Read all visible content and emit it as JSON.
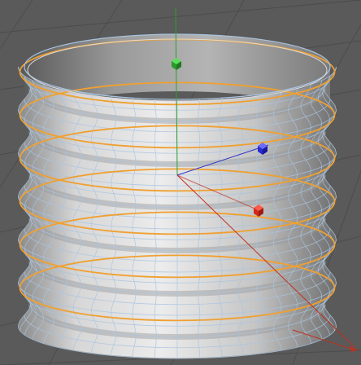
{
  "viewport": {
    "mode": "perspective",
    "background_color": "#5a5a5a",
    "grid_color": "#4a4a4a"
  },
  "object": {
    "type": "bellows-cylinder",
    "surface_color": "#c8c8c8",
    "wire_color": "#a9c4e0",
    "selected_edge_color": "#f0a030",
    "ring_count": 6
  },
  "gizmo": {
    "x_axis_color": "#e03020",
    "y_axis_color": "#30c030",
    "z_axis_color": "#3030e0",
    "x_handle": "x-axis-handle",
    "y_handle": "y-axis-handle",
    "z_handle": "z-axis-handle"
  }
}
